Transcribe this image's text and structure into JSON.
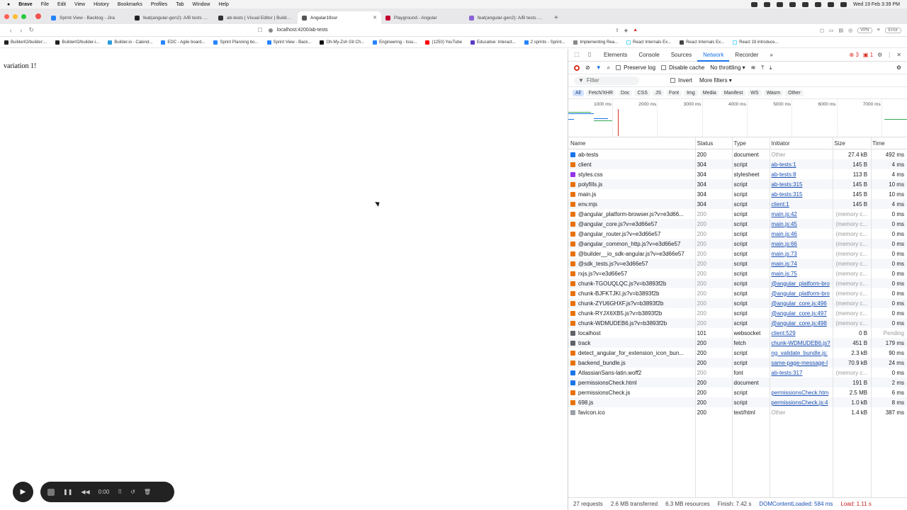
{
  "menubar": {
    "items": [
      "Brave",
      "File",
      "Edit",
      "View",
      "History",
      "Bookmarks",
      "Profiles",
      "Tab",
      "Window",
      "Help"
    ],
    "clock": "Wed 19 Feb 3:39 PM"
  },
  "tabs": [
    {
      "label": "Sprint View - Backlog - Jira",
      "color": "#2684ff"
    },
    {
      "label": "feat(angular-gen2): A/B tests sup",
      "color": "#222222"
    },
    {
      "label": "ab-tests | Visual Editor | Builder.io",
      "color": "#333333"
    },
    {
      "label": "Angular19ssr",
      "color": "#555555"
    },
    {
      "label": "Playground - Angular",
      "color": "#c3002f"
    },
    {
      "label": "feat(angular-gen2): A/B tests sup",
      "color": "#8a63d2"
    }
  ],
  "address": {
    "url": "localhost:4200/ab-tests",
    "vpn": "VPN",
    "error": "Error"
  },
  "bookmarks": [
    {
      "label": "BuilderIO/builder:...",
      "color": "#222222"
    },
    {
      "label": "BuilderIO/builder-i...",
      "color": "#222222"
    },
    {
      "label": "Builder.io - Calend...",
      "color": "#2d9cdb"
    },
    {
      "label": "EDC - Agile board...",
      "color": "#2684ff"
    },
    {
      "label": "Sprint Planning bo...",
      "color": "#2684ff"
    },
    {
      "label": "Sprint View - Back...",
      "color": "#2684ff"
    },
    {
      "label": "Oh-My-Zsh Git Ch...",
      "color": "#111111"
    },
    {
      "label": "Engineering - Issu...",
      "color": "#2684ff"
    },
    {
      "label": "(1250) YouTube",
      "color": "#ff0000"
    },
    {
      "label": "Educative: Interact...",
      "color": "#5b3cc4"
    },
    {
      "label": "2 sprints - Sprint...",
      "color": "#2684ff"
    },
    {
      "label": "Implementing Rea...",
      "color": "#888888"
    },
    {
      "label": "React Internals Ex...",
      "color": "#ffffff"
    },
    {
      "label": "React Internals Ex...",
      "color": "#444444"
    },
    {
      "label": "React 19 introduce...",
      "color": "#ffffff"
    }
  ],
  "page": {
    "text": "variation 1!"
  },
  "recorder": {
    "time": "0:00"
  },
  "devtools": {
    "tabs": [
      "Elements",
      "Console",
      "Sources",
      "Network",
      "Recorder"
    ],
    "active_tab": "Network",
    "errors": "3",
    "warnings": "1",
    "controls": {
      "preserve_log": "Preserve log",
      "disable_cache": "Disable cache",
      "throttling": "No throttling"
    },
    "filter": {
      "placeholder": "Filter",
      "invert": "Invert",
      "more_filters": "More filters"
    },
    "types": [
      "All",
      "Fetch/XHR",
      "Doc",
      "CSS",
      "JS",
      "Font",
      "Img",
      "Media",
      "Manifest",
      "WS",
      "Wasm",
      "Other"
    ],
    "timeline_labels": [
      "1000 ms",
      "2000 ms",
      "3000 ms",
      "4000 ms",
      "5000 ms",
      "6000 ms",
      "7000 ms"
    ],
    "columns": [
      "Name",
      "Status",
      "Type",
      "Initiator",
      "Size",
      "Time"
    ],
    "rows": [
      {
        "name": "ab-tests",
        "status": "200",
        "type": "document",
        "initiator": "Other",
        "size": "27.4 kB",
        "time": "492 ms",
        "icon": "doc",
        "init_link": false
      },
      {
        "name": "client",
        "status": "304",
        "type": "script",
        "initiator": "ab-tests:1",
        "size": "145 B",
        "time": "4 ms",
        "icon": "script",
        "init_link": true
      },
      {
        "name": "styles.css",
        "status": "304",
        "type": "stylesheet",
        "initiator": "ab-tests:8",
        "size": "113 B",
        "time": "4 ms",
        "icon": "css",
        "init_link": true
      },
      {
        "name": "polyfills.js",
        "status": "304",
        "type": "script",
        "initiator": "ab-tests:315",
        "size": "145 B",
        "time": "10 ms",
        "icon": "script",
        "init_link": true
      },
      {
        "name": "main.js",
        "status": "304",
        "type": "script",
        "initiator": "ab-tests:315",
        "size": "145 B",
        "time": "10 ms",
        "icon": "script",
        "init_link": true
      },
      {
        "name": "env.mjs",
        "status": "304",
        "type": "script",
        "initiator": "client:1",
        "size": "145 B",
        "time": "4 ms",
        "icon": "script",
        "init_link": true
      },
      {
        "name": "@angular_platform-browser.js?v=e3d66...",
        "status": "200",
        "type": "script",
        "initiator": "main.js:42",
        "size": "(memory c...",
        "time": "0 ms",
        "icon": "script",
        "init_link": true
      },
      {
        "name": "@angular_core.js?v=e3d66e57",
        "status": "200",
        "type": "script",
        "initiator": "main.js:45",
        "size": "(memory c...",
        "time": "0 ms",
        "icon": "script",
        "init_link": true
      },
      {
        "name": "@angular_router.js?v=e3d66e57",
        "status": "200",
        "type": "script",
        "initiator": "main.js:46",
        "size": "(memory c...",
        "time": "0 ms",
        "icon": "script",
        "init_link": true
      },
      {
        "name": "@angular_common_http.js?v=e3d66e57",
        "status": "200",
        "type": "script",
        "initiator": "main.js:66",
        "size": "(memory c...",
        "time": "0 ms",
        "icon": "script",
        "init_link": true
      },
      {
        "name": "@builder__io_sdk-angular.js?v=e3d66e57",
        "status": "200",
        "type": "script",
        "initiator": "main.js:73",
        "size": "(memory c...",
        "time": "0 ms",
        "icon": "script",
        "init_link": true
      },
      {
        "name": "@sdk_tests.js?v=e3d66e57",
        "status": "200",
        "type": "script",
        "initiator": "main.js:74",
        "size": "(memory c...",
        "time": "0 ms",
        "icon": "script",
        "init_link": true
      },
      {
        "name": "rxjs.js?v=e3d66e57",
        "status": "200",
        "type": "script",
        "initiator": "main.js:75",
        "size": "(memory c...",
        "time": "0 ms",
        "icon": "script",
        "init_link": true
      },
      {
        "name": "chunk-TGOUQLQC.js?v=b3893f2b",
        "status": "200",
        "type": "script",
        "initiator": "@angular_platform-bro",
        "size": "(memory c...",
        "time": "0 ms",
        "icon": "script",
        "init_link": true
      },
      {
        "name": "chunk-BJFKTJKI.js?v=b3893f2b",
        "status": "200",
        "type": "script",
        "initiator": "@angular_platform-bro",
        "size": "(memory c...",
        "time": "0 ms",
        "icon": "script",
        "init_link": true
      },
      {
        "name": "chunk-ZYU6GHXF.js?v=b3893f2b",
        "status": "200",
        "type": "script",
        "initiator": "@angular_core.js:496",
        "size": "(memory c...",
        "time": "0 ms",
        "icon": "script",
        "init_link": true
      },
      {
        "name": "chunk-RYJX6XB5.js?v=b3893f2b",
        "status": "200",
        "type": "script",
        "initiator": "@angular_core.js:497",
        "size": "(memory c...",
        "time": "0 ms",
        "icon": "script",
        "init_link": true
      },
      {
        "name": "chunk-WDMUDEB6.js?v=b3893f2b",
        "status": "200",
        "type": "script",
        "initiator": "@angular_core.js:498",
        "size": "(memory c...",
        "time": "0 ms",
        "icon": "script",
        "init_link": true
      },
      {
        "name": "localhost",
        "status": "101",
        "type": "websocket",
        "initiator": "client:529",
        "size": "0 B",
        "time": "Pending",
        "icon": "ws",
        "init_link": true
      },
      {
        "name": "track",
        "status": "200",
        "type": "fetch",
        "initiator": "chunk-WDMUDEB6.js?",
        "size": "451 B",
        "time": "179 ms",
        "icon": "fetch",
        "init_link": true
      },
      {
        "name": "detect_angular_for_extension_icon_bun...",
        "status": "200",
        "type": "script",
        "initiator": "ng_validate_bundle.js:",
        "size": "2.3 kB",
        "time": "90 ms",
        "icon": "script",
        "init_link": true
      },
      {
        "name": "backend_bundle.js",
        "status": "200",
        "type": "script",
        "initiator": "same-page-message-l",
        "size": "70.9 kB",
        "time": "24 ms",
        "icon": "script",
        "init_link": true
      },
      {
        "name": "AtlassianSans-latin.woff2",
        "status": "200",
        "type": "font",
        "initiator": "ab-tests:317",
        "size": "(memory c...",
        "time": "0 ms",
        "icon": "font",
        "init_link": true
      },
      {
        "name": "permissionsCheck.html",
        "status": "200",
        "type": "document",
        "initiator": "",
        "size": "191 B",
        "time": "2 ms",
        "icon": "doc",
        "init_link": false
      },
      {
        "name": "permissionsCheck.js",
        "status": "200",
        "type": "script",
        "initiator": "permissionsCheck.htm",
        "size": "2.5 MB",
        "time": "6 ms",
        "icon": "script",
        "init_link": true
      },
      {
        "name": "698.js",
        "status": "200",
        "type": "script",
        "initiator": "permissionsCheck.js:4",
        "size": "1.0 kB",
        "time": "8 ms",
        "icon": "script",
        "init_link": true
      },
      {
        "name": "favicon.ico",
        "status": "200",
        "type": "text/html",
        "initiator": "Other",
        "size": "1.4 kB",
        "time": "387 ms",
        "icon": "other",
        "init_link": false
      }
    ],
    "summary": {
      "requests": "27 requests",
      "transferred": "2.6 MB transferred",
      "resources": "6.3 MB resources",
      "finish": "Finish: 7.42 s",
      "dcl": "DOMContentLoaded: 584 ms",
      "load": "Load: 1.11 s"
    },
    "icon_colors": {
      "doc": "#1a73e8",
      "script": "#e8710a",
      "css": "#9334e6",
      "ws": "#5f6368",
      "fetch": "#5f6368",
      "font": "#1a73e8",
      "other": "#9aa0a6"
    }
  }
}
